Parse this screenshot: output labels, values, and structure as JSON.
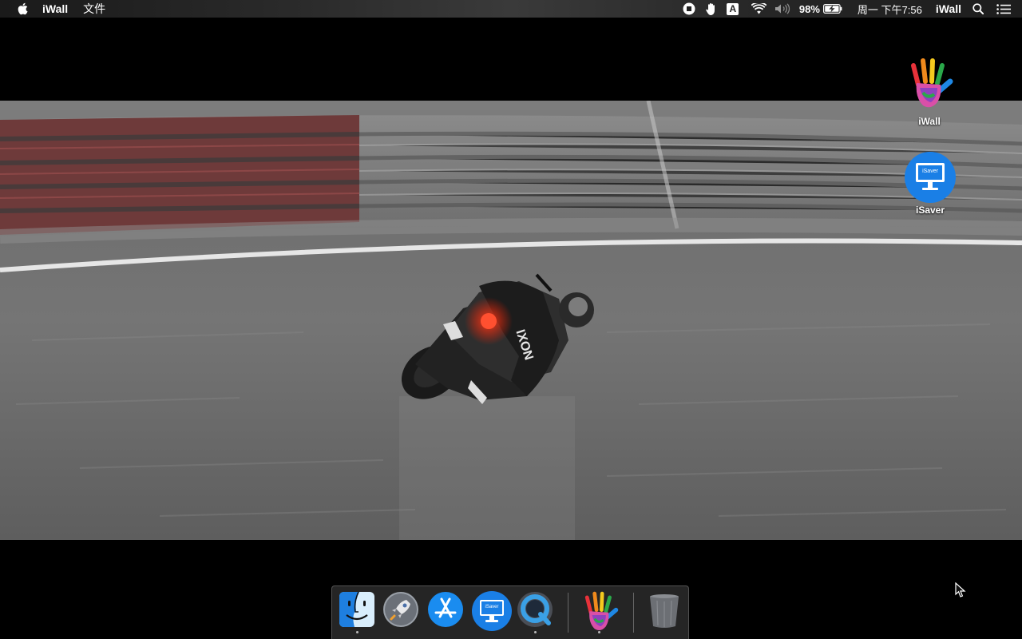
{
  "menubar": {
    "app_name": "iWall",
    "menu_items": [
      "文件"
    ],
    "status": {
      "battery_percent": "98%",
      "datetime": "周一 下午7:56",
      "app_label": "iWall",
      "input_method": "A"
    }
  },
  "desktop": {
    "icons": [
      {
        "label": "iWall",
        "icon": "iwall-hand-icon"
      },
      {
        "label": "iSaver",
        "icon": "isaver-monitor-icon",
        "badge": "iSaver"
      }
    ]
  },
  "wallpaper": {
    "rider_suit_text": "IXON"
  },
  "dock": {
    "items": [
      {
        "name": "Finder",
        "icon": "finder-icon",
        "running": true
      },
      {
        "name": "Launchpad",
        "icon": "rocket-icon",
        "running": false
      },
      {
        "name": "App Store",
        "icon": "app-store-icon",
        "running": false
      },
      {
        "name": "iSaver",
        "icon": "isaver-monitor-icon",
        "badge": "iSaver",
        "running": false
      },
      {
        "name": "QuickTime Player",
        "icon": "quicktime-icon",
        "running": true
      },
      {
        "name": "iWall",
        "icon": "iwall-hand-icon",
        "running": true
      },
      {
        "name": "Trash",
        "icon": "trash-icon",
        "running": false
      }
    ]
  },
  "colors": {
    "isaver_blue": "#1a7fe6",
    "menubar_bg": "#2b2b2b",
    "dock_bg": "#282828"
  }
}
